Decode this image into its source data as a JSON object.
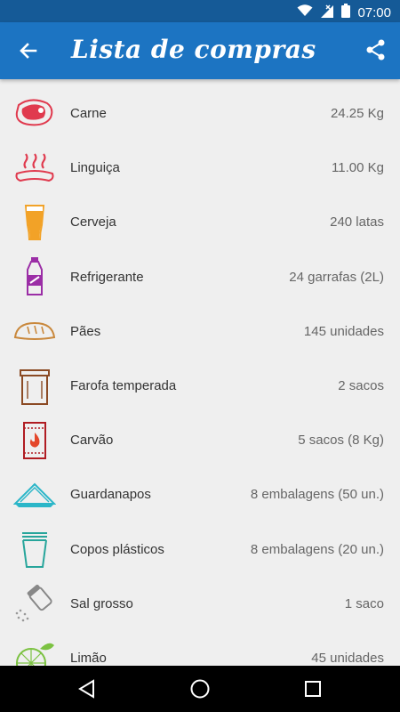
{
  "status_bar": {
    "time": "07:00"
  },
  "app_bar": {
    "title": "Lista de compras"
  },
  "items": [
    {
      "name": "Carne",
      "qty": "24.25 Kg",
      "icon": "meat-icon"
    },
    {
      "name": "Linguiça",
      "qty": "11.00 Kg",
      "icon": "sausage-icon"
    },
    {
      "name": "Cerveja",
      "qty": "240 latas",
      "icon": "beer-icon"
    },
    {
      "name": "Refrigerante",
      "qty": "24 garrafas (2L)",
      "icon": "soda-bottle-icon"
    },
    {
      "name": "Pães",
      "qty": "145 unidades",
      "icon": "bread-icon"
    },
    {
      "name": "Farofa temperada",
      "qty": "2 sacos",
      "icon": "farofa-bag-icon"
    },
    {
      "name": "Carvão",
      "qty": "5 sacos (8 Kg)",
      "icon": "charcoal-bag-icon"
    },
    {
      "name": "Guardanapos",
      "qty": "8 embalagens (50 un.)",
      "icon": "napkin-icon"
    },
    {
      "name": "Copos plásticos",
      "qty": "8 embalagens (20 un.)",
      "icon": "plastic-cup-icon"
    },
    {
      "name": "Sal grosso",
      "qty": "1 saco",
      "icon": "salt-shaker-icon"
    },
    {
      "name": "Limão",
      "qty": "45 unidades",
      "icon": "lemon-icon"
    }
  ],
  "colors": {
    "status_bar": "#155a97",
    "app_bar": "#1c74c2",
    "meat": "#e03a4e",
    "beer": "#f2a227",
    "soda": "#9b2ea6",
    "bread": "#c9883c",
    "farofa": "#8b4a24",
    "charcoal": "#b01c22",
    "napkin": "#2bb6c8",
    "cup": "#27a59b",
    "salt": "#888888",
    "lemon": "#7cc242"
  }
}
